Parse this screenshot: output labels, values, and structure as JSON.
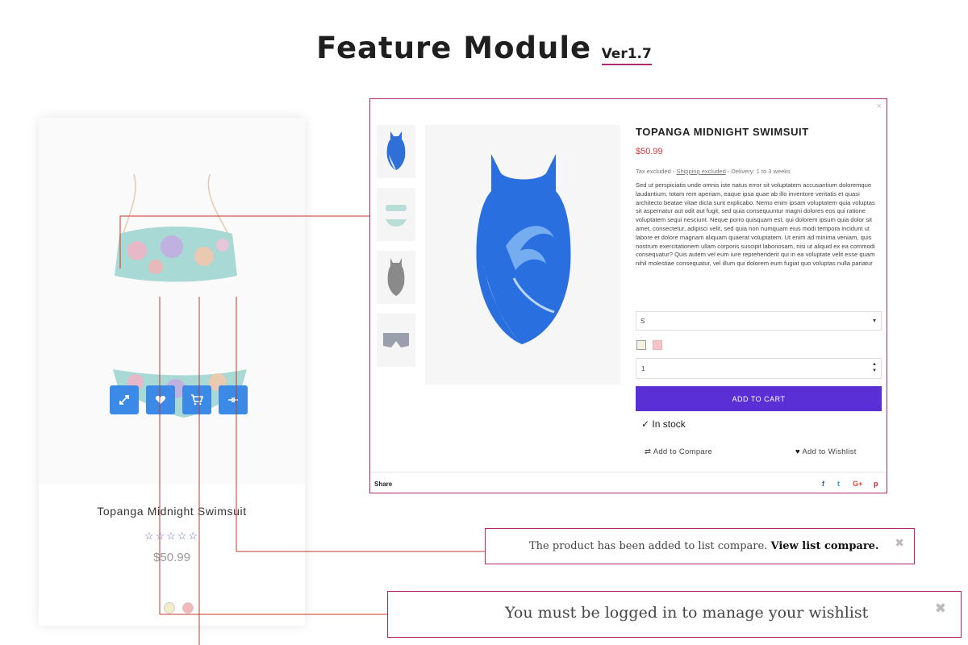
{
  "header": {
    "title": "Feature Module",
    "version": "Ver1.7"
  },
  "product_card": {
    "name": "Topanga Midnight Swimsuit",
    "rating_stars": "☆☆☆☆☆",
    "rating": 0,
    "price": "$50.99",
    "actions": [
      "quick-view",
      "wishlist",
      "add-to-cart",
      "compare"
    ],
    "swatches": [
      "#f3ecc8",
      "#f4b8b8"
    ]
  },
  "quick_view": {
    "close": "×",
    "title": "TOPANGA MIDNIGHT SWIMSUIT",
    "price": "$50.99",
    "tax_prefix": "Tax excluded -",
    "shipping_link": "Shipping excluded",
    "delivery": "- Delivery: 1 to 3 weeks",
    "description": "Sed ut perspiciatis unde omnis iste natus error sit voluptatem accusantium doloremque laudantium, totam rem aperiam, eaque ipsa quae ab illo inventore veritatis et quasi architecto beatae vitae dicta sunt explicabo. Nemo enim ipsam voluptatem quia voluptas sit aspernatur aut odit aut fugit, sed quia consequuntur magni dolores eos qui ratione voluptatem sequi nesciunt. Neque porro quisquam est, qui dolorem ipsum quia dolor sit amet, consectetur, adipisci velit, sed quia non numquam eius modi tempora incidunt ut labore et dolore magnam aliquam quaerat voluptatem. Ut enim ad minima veniam, quis nostrum exercitationem ullam corporis suscipit laboriosam, nisi ut aliquid ex ea commodi consequatur? Quis autem vel eum iure reprehenderit qui in ea voluptate velit esse quam nihil molestiae consequatur, vel illum qui dolorem eum fugiat quo voluptas nulla pariatur",
    "size_value": "S",
    "colors": [
      "#f3f3e0",
      "#f6c4c4"
    ],
    "quantity": "1",
    "add_to_cart": "ADD TO CART",
    "stock": "✓ In stock",
    "compare": "Add to Compare",
    "wishlist": "Add to Wishlist",
    "share": "Share",
    "social": [
      "f",
      "t",
      "G+",
      "p"
    ],
    "social_colors": [
      "#3b5998",
      "#1da1f2",
      "#dd4b39",
      "#cb2027"
    ]
  },
  "notifications": {
    "compare": {
      "text": "The product has been added to list compare.",
      "link": "View list compare."
    },
    "wishlist": {
      "text": "You must be logged in to manage your wishlist"
    },
    "close": "✖"
  },
  "colors": {
    "accent": "#b0296f",
    "button_blue": "#3c8ae8",
    "cart_purple": "#5b2fd6",
    "price_red": "#d23b3b"
  }
}
